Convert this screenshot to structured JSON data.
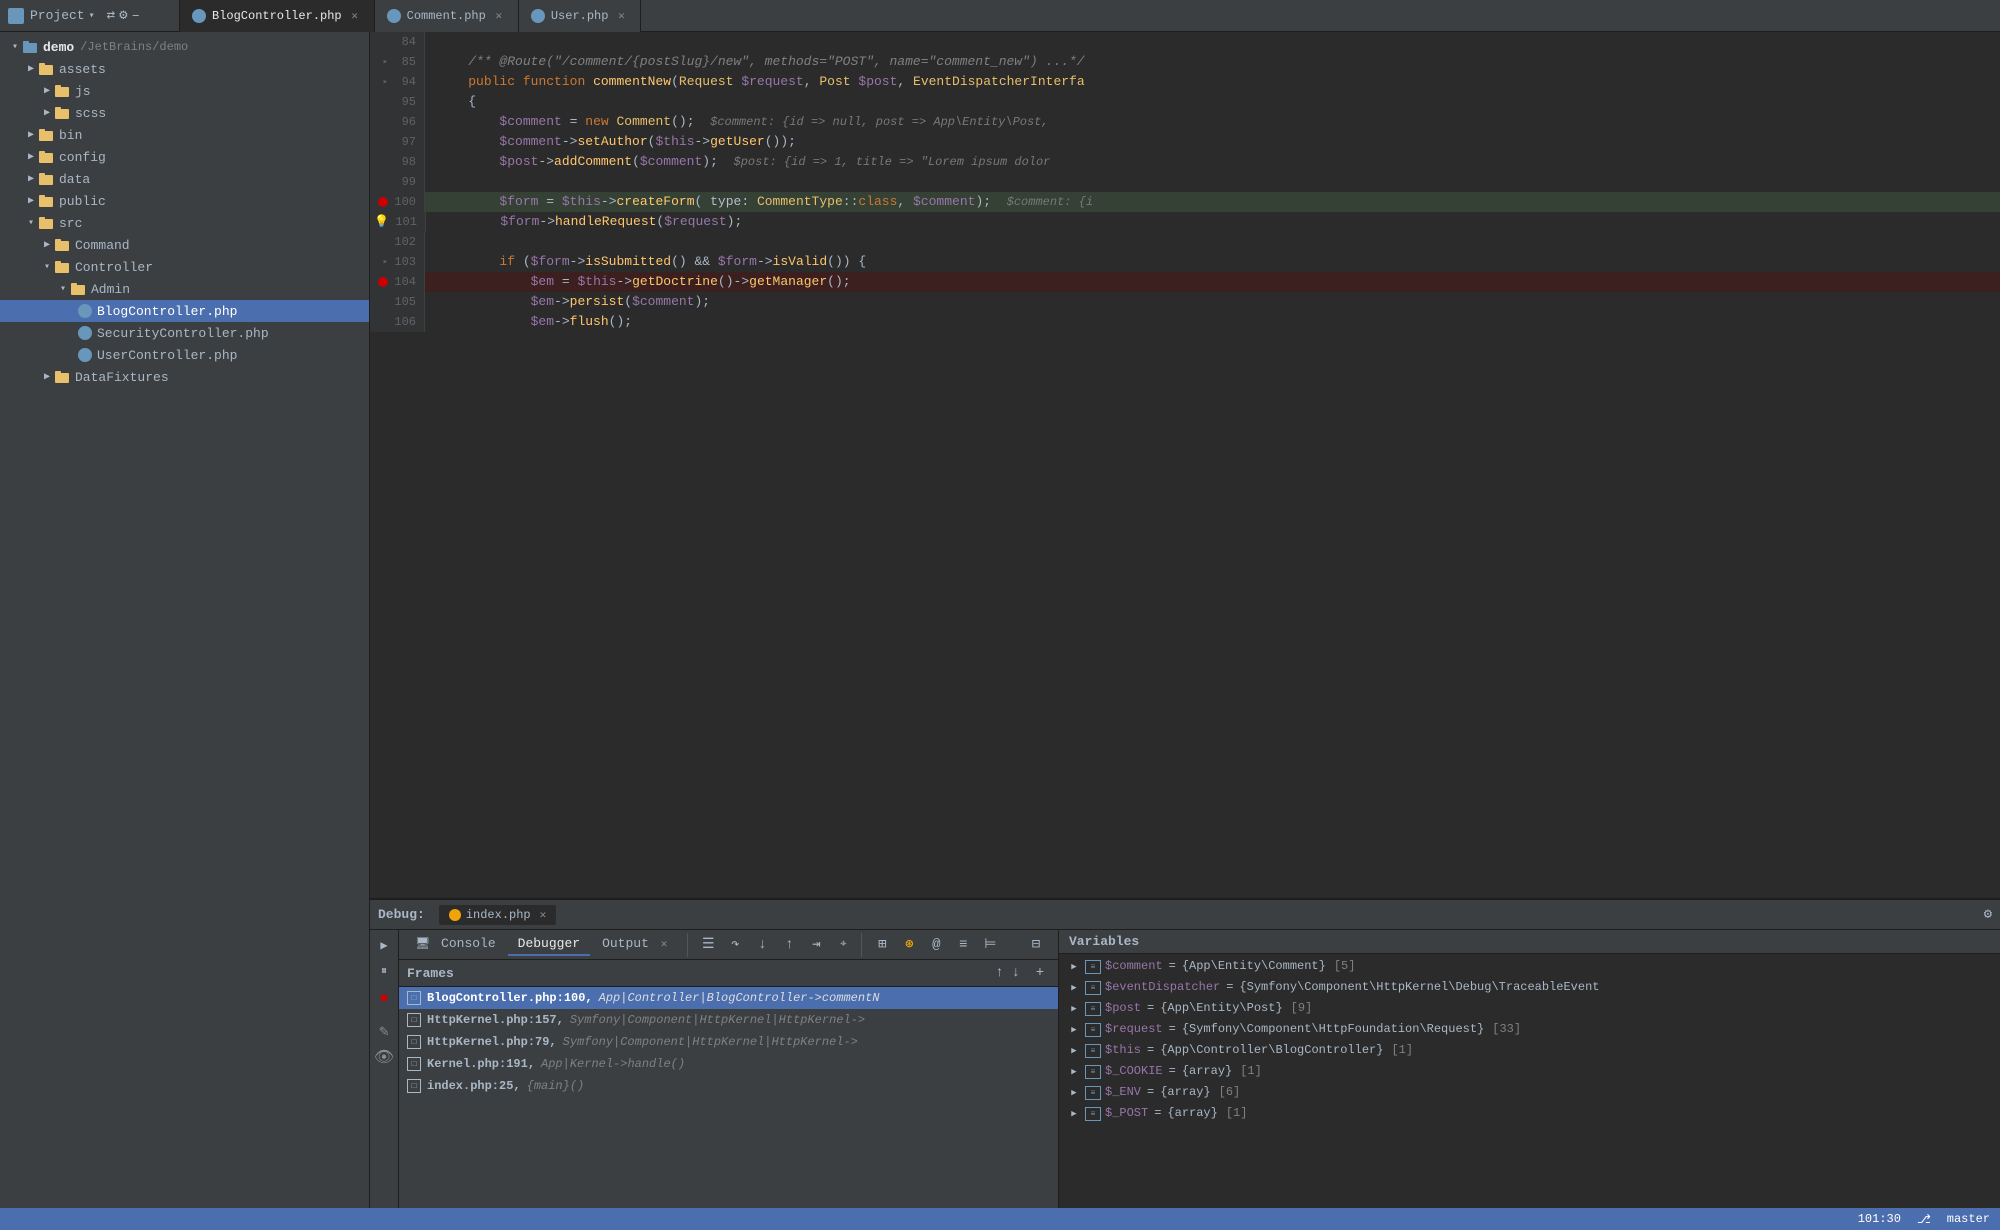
{
  "tabs": {
    "items": [
      {
        "label": "BlogController.php",
        "active": true,
        "closable": true
      },
      {
        "label": "Comment.php",
        "active": false,
        "closable": true
      },
      {
        "label": "User.php",
        "active": false,
        "closable": true
      }
    ]
  },
  "project": {
    "title": "Project",
    "root": "demo",
    "path": "/JetBrains/demo"
  },
  "sidebar": {
    "items": [
      {
        "label": "assets",
        "type": "folder",
        "indent": 0,
        "open": false
      },
      {
        "label": "js",
        "type": "folder",
        "indent": 1,
        "open": false
      },
      {
        "label": "scss",
        "type": "folder",
        "indent": 1,
        "open": false
      },
      {
        "label": "bin",
        "type": "folder",
        "indent": 0,
        "open": false
      },
      {
        "label": "config",
        "type": "folder",
        "indent": 0,
        "open": false
      },
      {
        "label": "data",
        "type": "folder",
        "indent": 0,
        "open": false
      },
      {
        "label": "public",
        "type": "folder",
        "indent": 0,
        "open": false
      },
      {
        "label": "src",
        "type": "folder",
        "indent": 0,
        "open": true
      },
      {
        "label": "Command",
        "type": "folder",
        "indent": 1,
        "open": false
      },
      {
        "label": "Controller",
        "type": "folder",
        "indent": 1,
        "open": true
      },
      {
        "label": "Admin",
        "type": "folder",
        "indent": 2,
        "open": true
      },
      {
        "label": "BlogController.php",
        "type": "file",
        "indent": 3,
        "selected": true
      },
      {
        "label": "SecurityController.php",
        "type": "file",
        "indent": 3
      },
      {
        "label": "UserController.php",
        "type": "file",
        "indent": 3
      },
      {
        "label": "DataFixtures",
        "type": "folder",
        "indent": 1,
        "open": false
      }
    ]
  },
  "editor": {
    "lines": [
      {
        "num": 84,
        "content": ""
      },
      {
        "num": 85,
        "content": "    /**  @Route(\"/comment/{postSlug}/new\",  methods=\"POST\",  name=\"comment_new\")  ...*/",
        "fold": true
      },
      {
        "num": 94,
        "content": "    public  function  commentNew(Request  $request,  Post  $post,  EventDispatcherIntefa",
        "fold": true
      },
      {
        "num": 95,
        "content": "    {"
      },
      {
        "num": 96,
        "content": "        $comment  =  new  Comment();     $comment:  {id  =>  null,  post  =>  App\\Entity\\Post,"
      },
      {
        "num": 97,
        "content": "        $comment->setAuthor($this->getUser());"
      },
      {
        "num": 98,
        "content": "        $post->addComment($comment);     $post:  {id  =>  1,  title  =>  \"Lorem  ipsum  dolor"
      },
      {
        "num": 99,
        "content": ""
      },
      {
        "num": 100,
        "content": "        $form  =  $this->createForm(  type:  CommentType::class,  $comment);    $comment:  {i",
        "highlight": true,
        "breakpoint": true
      },
      {
        "num": 101,
        "content": "        $form->handleRequest($request);",
        "warn": true
      },
      {
        "num": 102,
        "content": ""
      },
      {
        "num": 103,
        "content": "        if  ($form->isSubmitted()  &&  $form->isValid())  {",
        "fold": true
      },
      {
        "num": 104,
        "content": "            $em  =  $this->getDoctrine()->getManager();",
        "highlight_red": true,
        "breakpoint": true
      },
      {
        "num": 105,
        "content": "            $em->persist($comment);"
      },
      {
        "num": 106,
        "content": "            $em->flush();"
      }
    ]
  },
  "debug": {
    "title": "Debug:",
    "file": "index.php",
    "tabs": [
      {
        "label": "Console",
        "active": false
      },
      {
        "label": "Debugger",
        "active": true
      },
      {
        "label": "Output",
        "active": false
      }
    ],
    "frames_title": "Frames",
    "variables_title": "Variables",
    "frames": [
      {
        "file": "BlogController.php:100",
        "detail": " App|Controller|BlogController->commentN",
        "active": true
      },
      {
        "file": "HttpKernel.php:157",
        "detail": " Symfony|Component|HttpKernel|HttpKernel->",
        "active": false
      },
      {
        "file": "HttpKernel.php:79",
        "detail": " Symfony|Component|HttpKernel|HttpKernel->",
        "active": false
      },
      {
        "file": "Kernel.php:191",
        "detail": " App|Kernel->handle()",
        "active": false
      },
      {
        "file": "index.php:25",
        "detail": " {main}()",
        "active": false
      }
    ],
    "variables": [
      {
        "name": "$comment",
        "eq": "=",
        "value": "{App\\Entity\\Comment}",
        "meta": "[5]"
      },
      {
        "name": "$eventDispatcher",
        "eq": "=",
        "value": "{Symfony\\Component\\HttpKernel\\Debug\\TraceableEvent",
        "meta": ""
      },
      {
        "name": "$post",
        "eq": "=",
        "value": "{App\\Entity\\Post}",
        "meta": "[9]"
      },
      {
        "name": "$request",
        "eq": "=",
        "value": "{Symfony\\Component\\HttpFoundation\\Request}",
        "meta": "[33]"
      },
      {
        "name": "$this",
        "eq": "=",
        "value": "{App\\Controller\\BlogController}",
        "meta": "[1]"
      },
      {
        "name": "$_COOKIE",
        "eq": "=",
        "value": "{array}",
        "meta": "[1]"
      },
      {
        "name": "$_ENV",
        "eq": "=",
        "value": "{array}",
        "meta": "[6]"
      },
      {
        "name": "$_POST",
        "eq": "=",
        "value": "{array}",
        "meta": "[1]"
      }
    ]
  },
  "statusbar": {
    "position": "101:30",
    "branch": "master"
  }
}
